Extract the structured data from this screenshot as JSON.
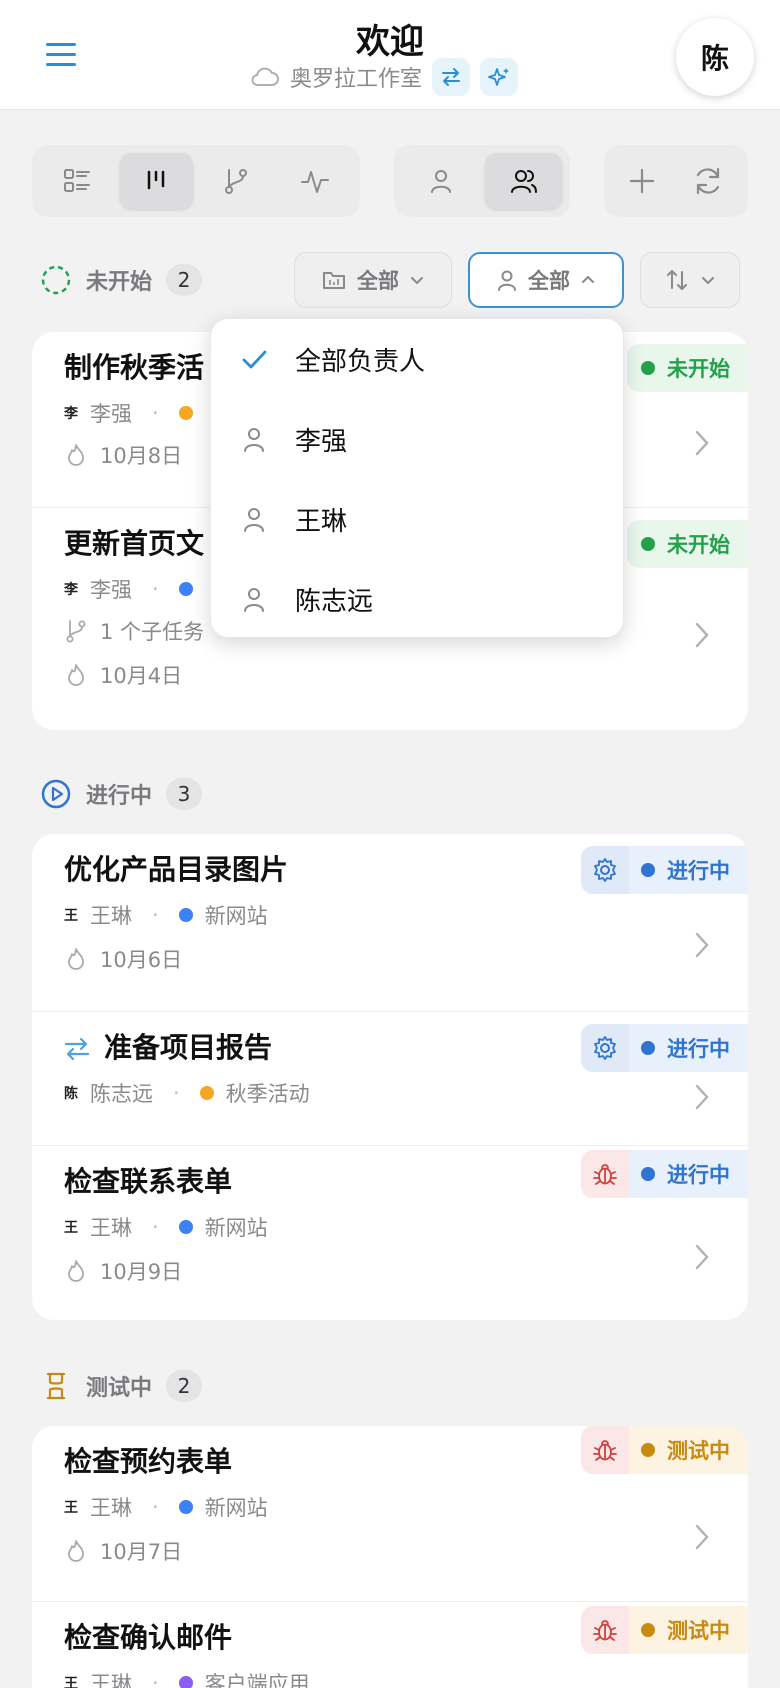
{
  "header": {
    "title": "欢迎",
    "workspace": "奥罗拉工作室",
    "avatar_initial": "陈"
  },
  "toolbar": {
    "view_modes": [
      "list-view",
      "board-view",
      "branch-view",
      "activity-view"
    ],
    "active_view": "board-view",
    "person_modes": [
      "single-person",
      "team"
    ],
    "active_person_mode": "team",
    "actions": [
      "add",
      "refresh"
    ]
  },
  "filters": {
    "project": "全部",
    "assignee": "全部",
    "sort": ""
  },
  "assignee_dropdown": {
    "items": [
      "全部负责人",
      "李强",
      "王琳",
      "陈志远"
    ],
    "selected": "全部负责人"
  },
  "sections": [
    {
      "label": "未开始",
      "count": "2",
      "tasks": [
        {
          "title": "制作秋季活",
          "assignee": "李强",
          "project_color": "#f5a623",
          "date": "10月8日",
          "status": "未开始"
        },
        {
          "title": "更新首页文",
          "assignee": "李强",
          "project_color": "#3b82f6",
          "subtasks": "1 个子任务",
          "date": "10月4日",
          "status": "未开始"
        }
      ]
    },
    {
      "label": "进行中",
      "count": "3",
      "tasks": [
        {
          "title": "优化产品目录图片",
          "assignee": "王琳",
          "project": "新网站",
          "project_color": "#3b82f6",
          "date": "10月6日",
          "status": "进行中",
          "type_icon": "gear-icon"
        },
        {
          "title": "准备项目报告",
          "assignee": "陈志远",
          "project": "秋季活动",
          "project_color": "#f5a623",
          "status": "进行中",
          "type_icon": "gear-icon",
          "recurring": true
        },
        {
          "title": "检查联系表单",
          "assignee": "王琳",
          "project": "新网站",
          "project_color": "#3b82f6",
          "date": "10月9日",
          "status": "进行中",
          "type_icon": "bug-icon"
        }
      ]
    },
    {
      "label": "测试中",
      "count": "2",
      "tasks": [
        {
          "title": "检查预约表单",
          "assignee": "王琳",
          "project": "新网站",
          "project_color": "#3b82f6",
          "date": "10月7日",
          "status": "测试中",
          "type_icon": "bug-icon"
        },
        {
          "title": "检查确认邮件",
          "assignee": "王琳",
          "project": "客户端应用",
          "project_color": "#8b5cf6",
          "status": "测试中",
          "type_icon": "bug-icon"
        }
      ]
    }
  ],
  "colors": {
    "accent": "#3b93d3",
    "not_started": "#22a34a",
    "in_progress": "#2f74d0",
    "testing": "#c98a10"
  }
}
